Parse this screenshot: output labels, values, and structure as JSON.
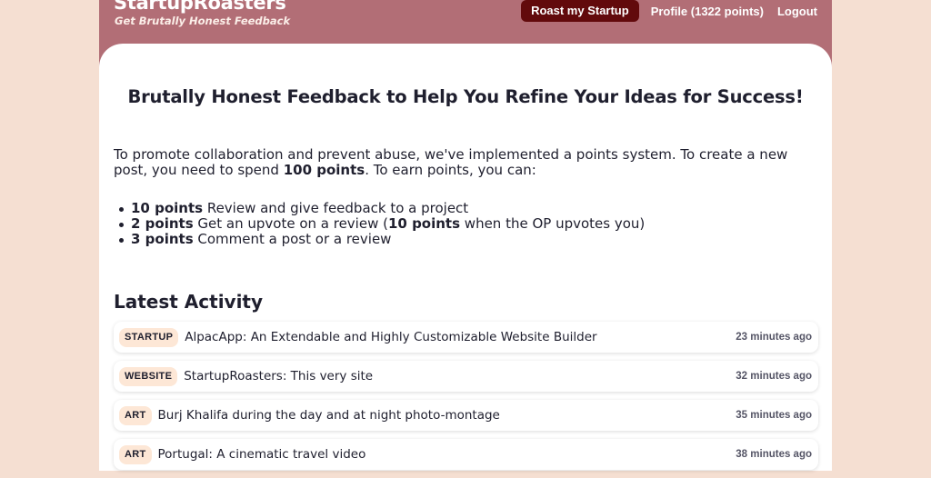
{
  "header": {
    "brand_name": "StartupRoasters",
    "tagline": "Get Brutally Honest Feedback",
    "roast_button": "Roast my Startup",
    "profile_link": "Profile (1322 points)",
    "logout_link": "Logout"
  },
  "main": {
    "headline": "Brutally Honest Feedback to Help You Refine Your Ideas for Success!",
    "intro_prefix": "To promote collaboration and prevent abuse, we've implemented a points system. To create a new post, you need to spend ",
    "intro_cost": "100 points",
    "intro_suffix": ". To earn points, you can:",
    "rules": [
      {
        "points": "10 points",
        "text": " Review and give feedback to a project"
      },
      {
        "points": "2 points",
        "text": " Get an upvote on a review (",
        "extra_points": "10 points",
        "extra_text": " when the OP upvotes you)"
      },
      {
        "points": "3 points",
        "text": " Comment a post or a review"
      }
    ],
    "activity_title": "Latest Activity",
    "activity": [
      {
        "tag": "STARTUP",
        "title": "AlpacApp: An Extendable and Highly Customizable Website Builder",
        "time": "23 minutes ago"
      },
      {
        "tag": "WEBSITE",
        "title": "StartupRoasters: This very site",
        "time": "32 minutes ago"
      },
      {
        "tag": "ART",
        "title": "Burj Khalifa during the day and at night photo-montage",
        "time": "35 minutes ago"
      },
      {
        "tag": "ART",
        "title": "Portugal: A cinematic travel video",
        "time": "38 minutes ago"
      }
    ]
  },
  "colors": {
    "page_background": "#f5dfd2",
    "header_background": "#b26e76",
    "primary_button": "#620a0c",
    "tag_background": "#fde7d6"
  }
}
